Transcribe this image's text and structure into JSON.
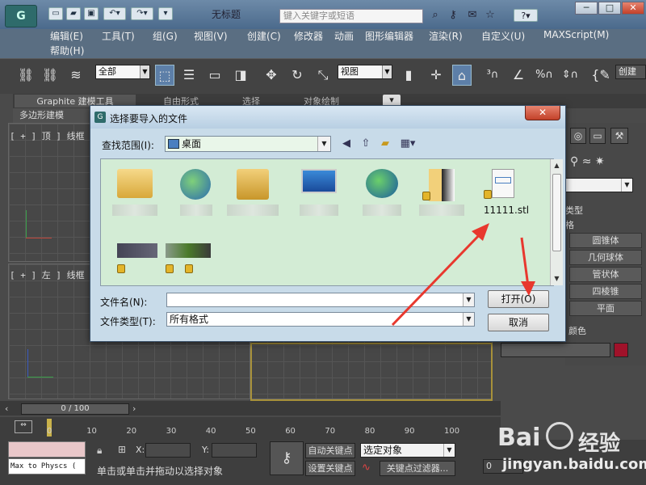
{
  "app": {
    "doc_title": "无标题",
    "search_placeholder": "键入关键字或短语",
    "logo_text": "G"
  },
  "window_buttons": {
    "minimize": "─",
    "maximize": "□",
    "close": "✕"
  },
  "menu": [
    "编辑(E)",
    "工具(T)",
    "组(G)",
    "视图(V)",
    "创建(C)",
    "修改器",
    "动画",
    "图形编辑器",
    "渲染(R)",
    "自定义(U)",
    "MAXScript(M)",
    "帮助(H)"
  ],
  "toolbar": {
    "selection_filter": "全部",
    "reference_coord": "视图",
    "create_selection_label": "创建"
  },
  "ribbon": {
    "tabs": [
      "Graphite 建模工具",
      "自由形式",
      "选择",
      "对象绘制"
    ],
    "sub_label": "多边形建模"
  },
  "viewports": {
    "top_label": "[ + ] 顶 ] 线框 ]",
    "left_label": "[ + ] 左 ] 线框 ]"
  },
  "right_panel": {
    "section_title": "类型",
    "section_sub": "格",
    "items": [
      "圆锥体",
      "几何球体",
      "管状体",
      "四棱锥",
      "平面"
    ],
    "color_label": "颜色",
    "accent": "#a0122a"
  },
  "timeline": {
    "frame_display": "0 / 100",
    "ticks": [
      "0",
      "10",
      "20",
      "30",
      "40",
      "50",
      "60",
      "70",
      "80",
      "90",
      "100"
    ]
  },
  "status": {
    "maxscript_text": "Max to Physcs (",
    "prompt": "单击或单击并拖动以选择对象",
    "x_label": "X:",
    "y_label": "Y:",
    "auto_key": "自动关键点",
    "set_key": "设置关键点",
    "selected_object": "选定对象",
    "key_filter": "关键点过滤器...",
    "frame_value": "0"
  },
  "dialog": {
    "title": "选择要导入的文件",
    "look_in_label": "查找范围(I):",
    "look_in_value": "桌面",
    "files": [
      {
        "name": "",
        "icon": "folder-open-icon"
      },
      {
        "name": "",
        "icon": "network-icon"
      },
      {
        "name": "",
        "icon": "user-folder-icon"
      },
      {
        "name": "",
        "icon": "computer-icon"
      },
      {
        "name": "",
        "icon": "globe-network-icon"
      },
      {
        "name": "",
        "icon": "locked-folder-icon"
      },
      {
        "name": "11111.stl",
        "icon": "stl-file-icon"
      },
      {
        "name": "",
        "icon": "thumbnail-icon"
      },
      {
        "name": "",
        "icon": "thumbnail-icon"
      }
    ],
    "filename_label": "文件名(N):",
    "filename_value": "",
    "filetype_label": "文件类型(T):",
    "filetype_value": "所有格式",
    "open_button": "打开(O)",
    "cancel_button": "取消",
    "arrow_color": "#e8382e"
  },
  "watermark": {
    "brand": "Bai",
    "brand2": "经验",
    "url": "jingyan.baidu.com"
  }
}
